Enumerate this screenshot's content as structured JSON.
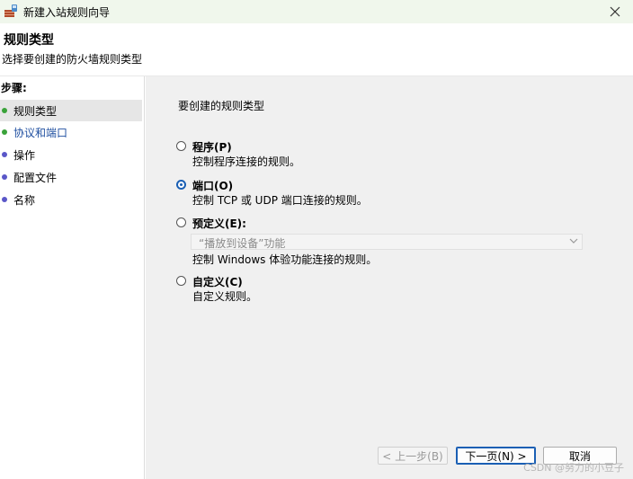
{
  "window": {
    "title": "新建入站规则向导",
    "close_glyph": "✕"
  },
  "header": {
    "title": "规则类型",
    "subtitle": "选择要创建的防火墙规则类型"
  },
  "sidebar": {
    "steps_label": "步骤:",
    "steps": [
      {
        "label": "规则类型",
        "dot_color": "#3aa33a"
      },
      {
        "label": "协议和端口",
        "dot_color": "#3aa33a"
      },
      {
        "label": "操作",
        "dot_color": "#5a57c8"
      },
      {
        "label": "配置文件",
        "dot_color": "#5a57c8"
      },
      {
        "label": "名称",
        "dot_color": "#5a57c8"
      }
    ]
  },
  "main": {
    "heading": "要创建的规则类型",
    "options": [
      {
        "label": "程序(P)",
        "description": "控制程序连接的规则。",
        "checked": false
      },
      {
        "label": "端口(O)",
        "description": "控制 TCP 或 UDP 端口连接的规则。",
        "checked": true
      },
      {
        "label": "预定义(E):",
        "description": "控制 Windows 体验功能连接的规则。",
        "checked": false
      },
      {
        "label": "自定义(C)",
        "description": "自定义规则。",
        "checked": false
      }
    ],
    "predefined_select": {
      "value": "“播放到设备”功能"
    }
  },
  "buttons": {
    "back": "< 上一步(B)",
    "next": "下一页(N) >",
    "cancel": "取消"
  },
  "watermark": "CSDN @努力的小豆子",
  "colors": {
    "accent": "#1a5fb4",
    "titlebar_bg": "#f0f7ec",
    "main_bg": "#f0f0f0"
  }
}
